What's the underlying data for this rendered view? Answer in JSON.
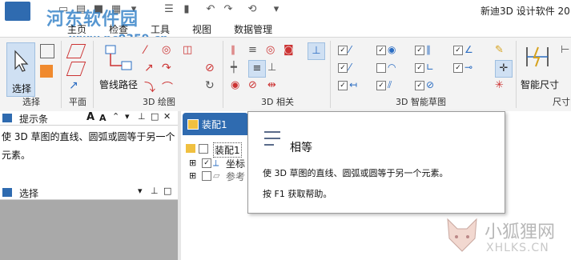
{
  "app": {
    "title": "新迪3D 设计软件 20"
  },
  "watermark": {
    "top_text": "河东软件园",
    "url": "www.pc0359.cn",
    "bottom_cn": "小狐狸网",
    "bottom_en": "XHLKS.CN"
  },
  "ribbon_tabs": [
    "主页",
    "检查",
    "工具",
    "视图",
    "数据管理"
  ],
  "ribbon": {
    "select_label": "选择",
    "select_group": "选择",
    "plane_group": "平面",
    "pipe_label": "管线路径",
    "draw3d_group": "3D 绘图",
    "rel3d_group": "3D 相关",
    "smart_group": "3D 智能草图",
    "smart_dim_label": "智能尺寸",
    "dim_group": "尺寸"
  },
  "hint_pane": {
    "title": "提示条",
    "text": "使 3D 草图的直线、圆弧或圆等于另一个元素。",
    "icons": [
      "font-larger-icon",
      "font-smaller-icon",
      "collapse-icon",
      "pin-icon",
      "restore-icon",
      "close-icon"
    ]
  },
  "select_pane": {
    "title": "选择"
  },
  "doc": {
    "tab_label": "装配1",
    "tree_root": "装配1",
    "tree_items": [
      "坐标",
      "参考"
    ]
  },
  "tooltip": {
    "title": "相等",
    "description": "使 3D 草图的直线、圆弧或圆等于另一个元素。",
    "help": "按 F1 获取帮助。"
  },
  "colors": {
    "accent": "#2f6bb0",
    "ribbon_bg": "#f3f3f3",
    "select_body": "#a9a9a9"
  }
}
